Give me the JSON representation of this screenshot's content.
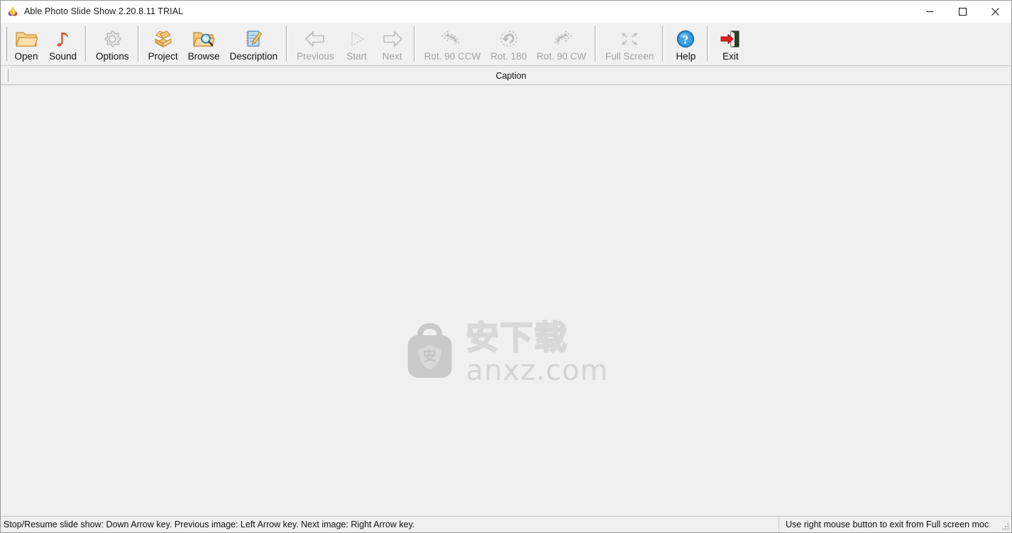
{
  "window": {
    "title": "Able Photo Slide Show 2.20.8.11 TRIAL",
    "app_icon": "app-logo-icon",
    "controls": {
      "minimize_label": "Minimize",
      "maximize_label": "Maximize",
      "close_label": "Close"
    }
  },
  "toolbar": {
    "buttons": [
      {
        "label": "Open",
        "icon": "open-folder-icon",
        "enabled": true
      },
      {
        "label": "Sound",
        "icon": "music-note-icon",
        "enabled": true
      },
      {
        "label": "Options",
        "icon": "gear-icon",
        "enabled": true
      },
      {
        "label": "Project",
        "icon": "open-box-icon",
        "enabled": true
      },
      {
        "label": "Browse",
        "icon": "folder-search-icon",
        "enabled": true
      },
      {
        "label": "Description",
        "icon": "notepad-pencil-icon",
        "enabled": true
      },
      {
        "label": "Previous",
        "icon": "arrow-left-icon",
        "enabled": false
      },
      {
        "label": "Start",
        "icon": "play-triangle-icon",
        "enabled": false
      },
      {
        "label": "Next",
        "icon": "arrow-right-icon",
        "enabled": false
      },
      {
        "label": "Rot. 90 CCW",
        "icon": "rotate-ccw-icon",
        "enabled": false
      },
      {
        "label": "Rot. 180",
        "icon": "rotate-180-icon",
        "enabled": false
      },
      {
        "label": "Rot. 90 CW",
        "icon": "rotate-cw-icon",
        "enabled": false
      },
      {
        "label": "Full Screen",
        "icon": "fullscreen-icon",
        "enabled": false
      },
      {
        "label": "Help",
        "icon": "help-question-icon",
        "enabled": true
      },
      {
        "label": "Exit",
        "icon": "exit-door-icon",
        "enabled": true
      }
    ]
  },
  "caption": {
    "label": "Caption",
    "value": "",
    "placeholder": ""
  },
  "canvas": {
    "watermark": {
      "chinese_text": "安下载",
      "domain_text": "anxz.com",
      "badge_char": "安",
      "color": "#d4d4d4"
    }
  },
  "statusbar": {
    "left_text": "Stop/Resume slide show: Down Arrow key. Previous image: Left Arrow key. Next image: Right Arrow key.",
    "right_text": "Use right mouse button to exit from Full screen moc"
  },
  "colors": {
    "window_bg": "#f0f0f0",
    "titlebar_bg": "#ffffff",
    "text": "#101010",
    "disabled_text": "#a4a4a4",
    "folder_orange": "#f5c36a",
    "note_red": "#e0512f",
    "help_blue": "#1a7fd4",
    "exit_red": "#e0201a"
  }
}
